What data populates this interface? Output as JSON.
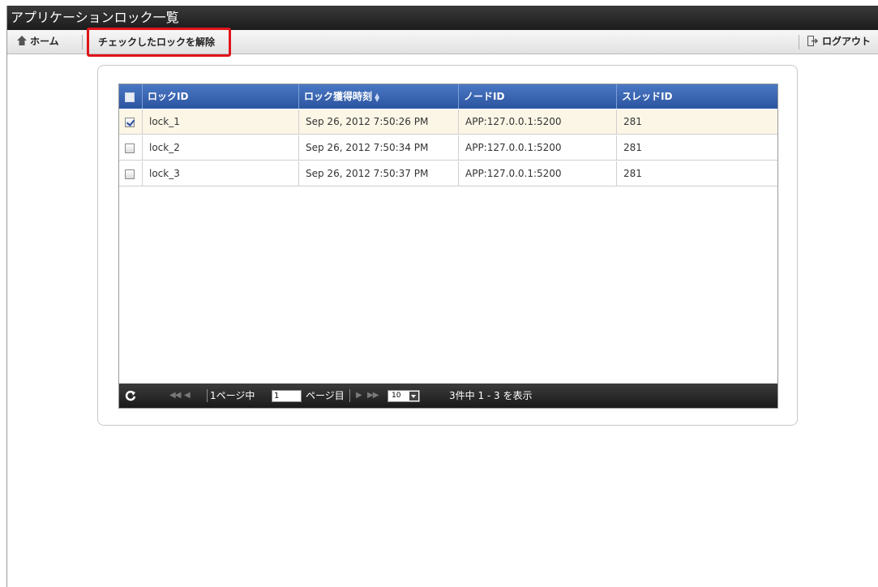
{
  "window": {
    "title": "アプリケーションロック一覧"
  },
  "toolbar": {
    "home_label": "ホーム",
    "release_label": "チェックしたロックを解除",
    "logout_label": "ログアウト",
    "home_icon": "home-icon",
    "logout_icon": "logout-icon"
  },
  "grid": {
    "columns": [
      "ロックID",
      "ロック獲得時刻",
      "ノードID",
      "スレッドID"
    ],
    "sorted_column": "ロック獲得時刻",
    "rows": [
      {
        "checked": true,
        "lock_id": "lock_1",
        "time": "Sep 26, 2012 7:50:26 PM",
        "node": "APP:127.0.0.1:5200",
        "thread": "281"
      },
      {
        "checked": false,
        "lock_id": "lock_2",
        "time": "Sep 26, 2012 7:50:34 PM",
        "node": "APP:127.0.0.1:5200",
        "thread": "281"
      },
      {
        "checked": false,
        "lock_id": "lock_3",
        "time": "Sep 26, 2012 7:50:37 PM",
        "node": "APP:127.0.0.1:5200",
        "thread": "281"
      }
    ],
    "pager": {
      "page_prefix": "1ページ中",
      "page_value": "1",
      "page_suffix": "ページ目",
      "page_size": "10",
      "summary": "3件中 1 - 3 を表示"
    }
  },
  "colors": {
    "header_blue": "#2c54a0",
    "highlight_red": "#e0141b",
    "selected_row": "#fbf6e6"
  }
}
